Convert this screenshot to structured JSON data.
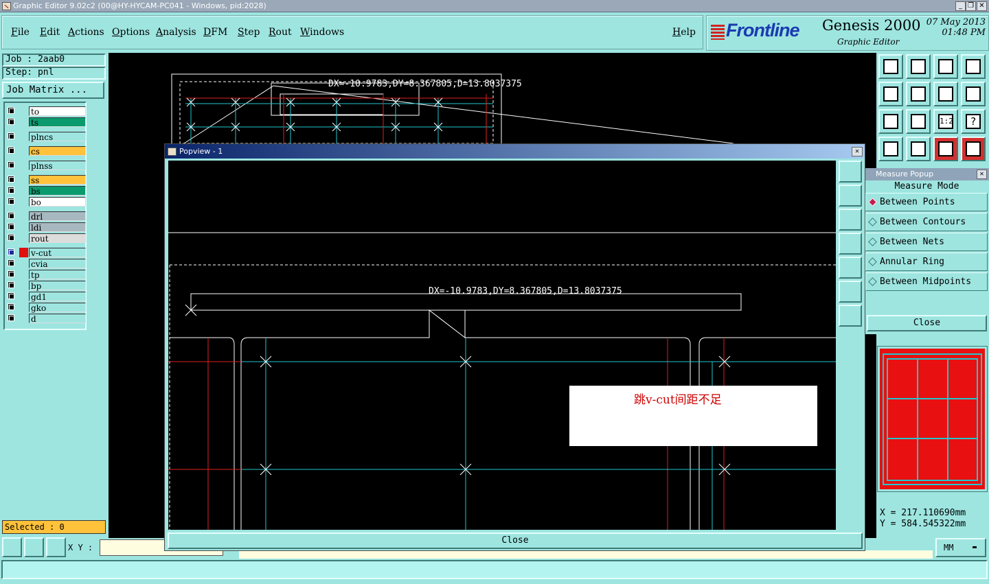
{
  "window": {
    "title": "Graphic Editor 9.02c2 (00@HY-HYCAM-PC041 - Windows, pid:2028)"
  },
  "menu": {
    "items": [
      "File",
      "Edit",
      "Actions",
      "Options",
      "Analysis",
      "DFM",
      "Step",
      "Rout",
      "Windows"
    ],
    "help": "Help"
  },
  "brand": {
    "logo": "Frontline",
    "product": "Genesis 2000",
    "subtitle": "Graphic Editor",
    "date": "07 May 2013",
    "time": "01:48 PM"
  },
  "job": {
    "job_label": "Job : 2aab0",
    "step_label": "Step: pnl",
    "matrix_button": "Job Matrix ..."
  },
  "layers": [
    {
      "name": "to",
      "color": "#ffffff"
    },
    {
      "name": "ts",
      "color": "#0a9a6e"
    },
    {
      "name": "plncs",
      "color": "#9ee5e0"
    },
    {
      "name": "cs",
      "color": "#ffc23a"
    },
    {
      "name": "plnss",
      "color": "#9ee5e0"
    },
    {
      "name": "ss",
      "color": "#ffc23a"
    },
    {
      "name": "bs",
      "color": "#0a9a6e"
    },
    {
      "name": "bo",
      "color": "#ffffff"
    },
    {
      "name": "drl",
      "color": "#a8b8c0"
    },
    {
      "name": "ldi",
      "color": "#a8b8c0"
    },
    {
      "name": "rout",
      "color": "#dcdcdc"
    },
    {
      "name": "v-cut",
      "color": "#9ee5e0",
      "active": true
    },
    {
      "name": "cvia",
      "color": "#9ee5e0"
    },
    {
      "name": "tp",
      "color": "#9ee5e0"
    },
    {
      "name": "bp",
      "color": "#9ee5e0"
    },
    {
      "name": "gd1",
      "color": "#9ee5e0"
    },
    {
      "name": "gko",
      "color": "#9ee5e0"
    },
    {
      "name": "d",
      "color": "#9ee5e0"
    }
  ],
  "selected": "Selected : 0",
  "xy_label": "X Y :",
  "canvas": {
    "measure_text": "DX=-10.9783,DY=8.367805,D=13.8037375"
  },
  "popview": {
    "title": "Popview - 1",
    "close": "Close",
    "measure_text": "DX=-10.9783,DY=8.367805,D=13.8037375",
    "note": "跳v-cut间距不足"
  },
  "measure_popup": {
    "title": "Measure Popup",
    "mode_label": "Measure Mode",
    "modes": [
      {
        "label": "Between Points",
        "selected": true
      },
      {
        "label": "Between Contours",
        "selected": false
      },
      {
        "label": "Between Nets",
        "selected": false
      },
      {
        "label": "Annular Ring",
        "selected": false
      },
      {
        "label": "Between Midpoints",
        "selected": false
      }
    ],
    "close": "Close"
  },
  "coords": {
    "x": "X  = 217.110690mm",
    "y": "Y  = 584.545322mm"
  },
  "units": "MM",
  "toolbar_icons": [
    "zoom-home-icon",
    "zoom-up-icon",
    "home-icon",
    "split-view-icon",
    "pan-left-icon",
    "pan-right-icon",
    "rotate-icon",
    "snap-icon",
    "fit-icon",
    "center-icon",
    "scale-1-2-icon",
    "help-icon",
    "tools-icon",
    "grid-icon",
    "netlist-icon",
    "netlist-compare-icon"
  ]
}
